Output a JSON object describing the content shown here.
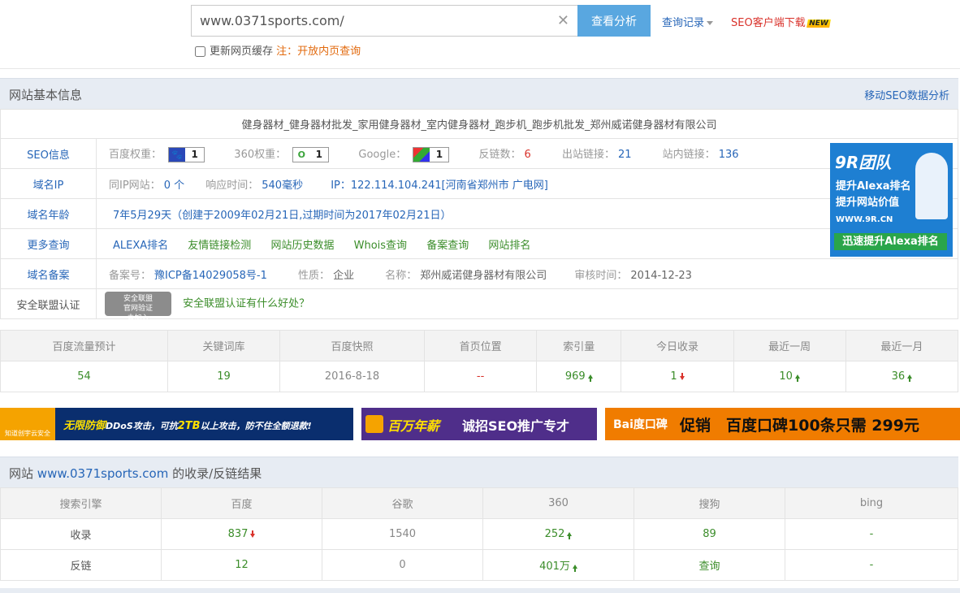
{
  "search": {
    "value": "www.0371sports.com/",
    "button": "查看分析",
    "history": "查询记录",
    "download": "SEO客户端下载",
    "new_badge": "NEW",
    "cache_label": "更新网页缓存",
    "cache_note": "注：开放内页查询"
  },
  "basic": {
    "title": "网站基本信息",
    "mobile_link": "移动SEO数据分析",
    "site_title": "健身器材_健身器材批发_家用健身器材_室内健身器材_跑步机_跑步机批发_郑州威诺健身器材有限公司",
    "seo": {
      "label": "SEO信息",
      "baidu_label": "百度权重：",
      "baidu_value": "1",
      "w360_label": "360权重：",
      "w360_value": "1",
      "google_label": "Google：",
      "google_value": "1",
      "backlinks_label": "反链数：",
      "backlinks_value": "6",
      "outlinks_label": "出站链接：",
      "outlinks_value": "21",
      "inlinks_label": "站内链接：",
      "inlinks_value": "136"
    },
    "ip": {
      "label": "域名IP",
      "same_ip_label": "同IP网站：",
      "same_ip_value": "0 个",
      "response_label": "响应时间：",
      "response_value": "540毫秒",
      "ip_value": "IP：122.114.104.241[河南省郑州市 广电网]"
    },
    "age": {
      "label": "域名年龄",
      "value": "7年5月29天（创建于2009年02月21日,过期时间为2017年02月21日）"
    },
    "more": {
      "label": "更多查询",
      "links": [
        "ALEXA排名",
        "友情链接检测",
        "网站历史数据",
        "Whois查询",
        "备案查询",
        "网站排名"
      ]
    },
    "beian": {
      "label": "域名备案",
      "no_label": "备案号：",
      "no_value": "豫ICP备14029058号-1",
      "nature_label": "性质：",
      "nature_value": "企业",
      "name_label": "名称：",
      "name_value": "郑州威诺健身器材有限公司",
      "audit_label": "审核时间：",
      "audit_value": "2014-12-23"
    },
    "security": {
      "label": "安全联盟认证",
      "seal_top": "安全联盟",
      "seal_mid": "官网验证",
      "seal_bottom": "未加入",
      "link": "安全联盟认证有什么好处？"
    }
  },
  "ad9r": {
    "title": "9R团队",
    "line1": "提升Alexa排名",
    "line2": "提升网站价值",
    "url": "WWW.9R.CN",
    "slogan": "迅速提升Alexa排名"
  },
  "stats": {
    "headers": [
      "百度流量预计",
      "关键词库",
      "百度快照",
      "首页位置",
      "索引量",
      "今日收录",
      "最近一周",
      "最近一月"
    ],
    "values": [
      "54",
      "19",
      "2016-8-18",
      "--",
      "969",
      "1",
      "10",
      "36"
    ]
  },
  "banners": {
    "b1_logo": "知道创宇云安全",
    "b1_a": "无限防御",
    "b1_b": "DDoS攻击，可抗",
    "b1_c": "2TB",
    "b1_d": "以上攻击，防不住全额退款!",
    "b2_a": "百万年薪",
    "b2_b": "诚招SEO推广专才",
    "b3_logo": "Bai度口碑",
    "b3_text": "促销　百度口碑100条只需 299元"
  },
  "result": {
    "title_prefix": "网站",
    "title_site": "www.0371sports.com",
    "title_suffix": "的收录/反链结果",
    "headers": [
      "搜索引擎",
      "百度",
      "谷歌",
      "360",
      "搜狗",
      "bing"
    ],
    "row1": [
      "收录",
      "837",
      "1540",
      "252",
      "89",
      "-"
    ],
    "row2": [
      "反链",
      "12",
      "0",
      "401万",
      "查询",
      "-"
    ]
  }
}
